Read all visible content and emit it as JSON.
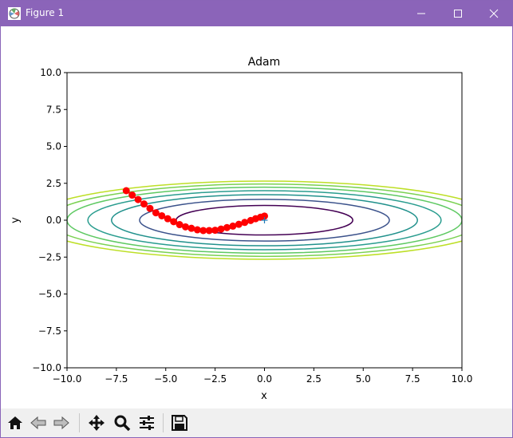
{
  "window": {
    "title": "Figure 1",
    "titlebar_color": "#8b64b9"
  },
  "toolbar": {
    "buttons": [
      {
        "name": "home",
        "icon": "home-icon"
      },
      {
        "name": "back",
        "icon": "back-arrow-icon"
      },
      {
        "name": "forward",
        "icon": "forward-arrow-icon"
      },
      {
        "name": "pan",
        "icon": "move-icon"
      },
      {
        "name": "zoom",
        "icon": "magnifier-icon"
      },
      {
        "name": "configure",
        "icon": "sliders-icon"
      },
      {
        "name": "save",
        "icon": "floppy-disk-icon"
      }
    ]
  },
  "chart_data": {
    "type": "contour",
    "title": "Adam",
    "xlabel": "x",
    "ylabel": "y",
    "xlim": [
      -10,
      10
    ],
    "ylim": [
      -10,
      10
    ],
    "x_ticks": [
      "−10.0",
      "−7.5",
      "−5.0",
      "−2.5",
      "0.0",
      "2.5",
      "5.0",
      "7.5",
      "10.0"
    ],
    "y_ticks": [
      "10.0",
      "7.5",
      "5.0",
      "2.5",
      "0.0",
      "−2.5",
      "−5.0",
      "−7.5",
      "−10.0"
    ],
    "x_tick_values": [
      -10,
      -7.5,
      -5,
      -2.5,
      0,
      2.5,
      5,
      7.5,
      10
    ],
    "y_tick_values": [
      10,
      7.5,
      5,
      2.5,
      0,
      -2.5,
      -5,
      -7.5,
      -10
    ],
    "function": "f(x,y) = x^2/20 + y^2",
    "contour_levels": [
      1,
      2,
      3,
      4,
      5,
      6,
      7
    ],
    "contour_colors": [
      "#440154",
      "#3b528b",
      "#21918c",
      "#2a9d8f",
      "#5ec962",
      "#7ad151",
      "#bddf26"
    ],
    "minimum_marker": {
      "x": 0,
      "y": 0,
      "symbol": "+",
      "color": "#1f77b4"
    },
    "path_color": "#ff0000",
    "path": [
      [
        -7.0,
        2.0
      ],
      [
        -6.7,
        1.7
      ],
      [
        -6.4,
        1.4
      ],
      [
        -6.1,
        1.1
      ],
      [
        -5.8,
        0.8
      ],
      [
        -5.5,
        0.5
      ],
      [
        -5.2,
        0.3
      ],
      [
        -4.9,
        0.1
      ],
      [
        -4.6,
        -0.1
      ],
      [
        -4.3,
        -0.3
      ],
      [
        -4.0,
        -0.45
      ],
      [
        -3.7,
        -0.55
      ],
      [
        -3.4,
        -0.65
      ],
      [
        -3.1,
        -0.7
      ],
      [
        -2.8,
        -0.7
      ],
      [
        -2.5,
        -0.68
      ],
      [
        -2.2,
        -0.6
      ],
      [
        -1.9,
        -0.5
      ],
      [
        -1.6,
        -0.4
      ],
      [
        -1.3,
        -0.28
      ],
      [
        -1.0,
        -0.15
      ],
      [
        -0.7,
        -0.02
      ],
      [
        -0.45,
        0.1
      ],
      [
        -0.2,
        0.2
      ],
      [
        0.0,
        0.28
      ]
    ]
  }
}
